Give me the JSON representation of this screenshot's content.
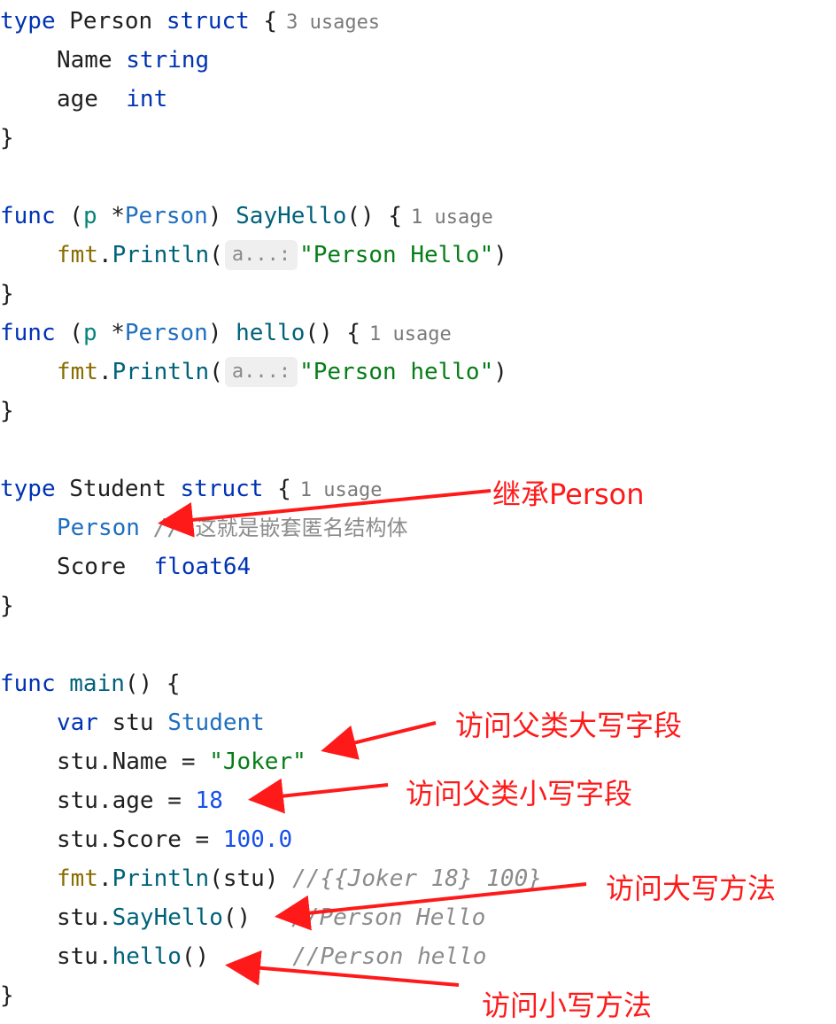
{
  "code": {
    "l1": {
      "kw_type": "type",
      "name": " Person ",
      "kw_struct": "struct",
      "brace": " {",
      "usage": "3 usages"
    },
    "l2": {
      "field": "Name ",
      "ftype": "string"
    },
    "l3": {
      "field": "age  ",
      "ftype": "int"
    },
    "l4": {
      "brace": "}"
    },
    "l6": {
      "kw": "func",
      "open": " (",
      "param": "p",
      "star": " *",
      "recv": "Person",
      "close": ") ",
      "fn": "SayHello",
      "tail": "() {",
      "usage": "1 usage"
    },
    "l7": {
      "pkg": "fmt",
      "dot": ".",
      "fn": "Println",
      "open": "(",
      "hint": "a...:",
      "str": "\"Person Hello\"",
      "close": ")"
    },
    "l8": {
      "brace": "}"
    },
    "l9": {
      "kw": "func",
      "open": " (",
      "param": "p",
      "star": " *",
      "recv": "Person",
      "close": ") ",
      "fn": "hello",
      "tail": "() {",
      "usage": "1 usage"
    },
    "l10": {
      "pkg": "fmt",
      "dot": ".",
      "fn": "Println",
      "open": "(",
      "hint": "a...:",
      "str": "\"Person hello\"",
      "close": ")"
    },
    "l11": {
      "brace": "}"
    },
    "l13": {
      "kw_type": "type",
      "name": " Student ",
      "kw_struct": "struct",
      "brace": " {",
      "usage": "1 usage"
    },
    "l14": {
      "embed": "Person",
      "slashes": " // ",
      "comment": "这就是嵌套匿名结构体"
    },
    "l15": {
      "field": "Score  ",
      "ftype": "float64"
    },
    "l16": {
      "brace": "}"
    },
    "l18": {
      "kw": "func",
      "fn": " main",
      "tail": "() {"
    },
    "l19": {
      "kw": "var",
      "var": " stu ",
      "ty": "Student"
    },
    "l20": {
      "lhs": "stu.Name = ",
      "str": "\"Joker\""
    },
    "l21": {
      "lhs": "stu.age = ",
      "num": "18"
    },
    "l22": {
      "lhs": "stu.Score = ",
      "num": "100.0"
    },
    "l23": {
      "pkg": "fmt",
      "dot": ".",
      "fn": "Println",
      "args": "(stu) ",
      "comment": "//{{Joker 18} 100}"
    },
    "l24": {
      "obj": "stu.",
      "fn": "SayHello",
      "tail": "()",
      "comment": "//Person Hello"
    },
    "l25": {
      "obj": "stu.",
      "fn": "hello",
      "tail": "()",
      "comment": "//Person hello"
    },
    "l26": {
      "brace": "}"
    }
  },
  "annotations": {
    "inherit": "继承Person",
    "upper_field": "访问父类大写字段",
    "lower_field": "访问父类小写字段",
    "upper_method": "访问大写方法",
    "lower_method": "访问小写方法"
  },
  "colors": {
    "annotation": "#ff1a1a",
    "keyword": "#0033b3",
    "string": "#067d17",
    "number": "#1750eb",
    "comment": "#8c8c8c"
  }
}
